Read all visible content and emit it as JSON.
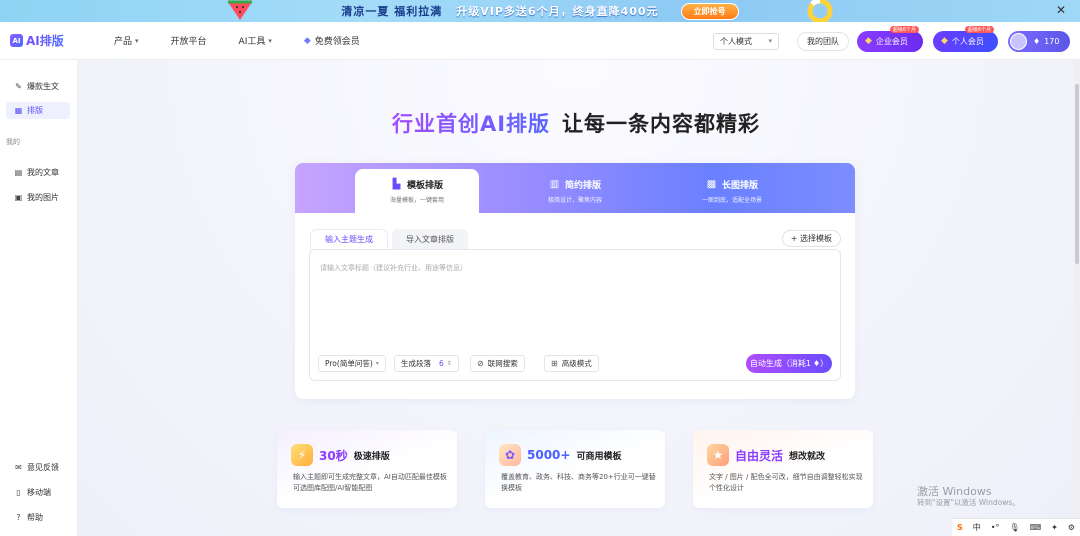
{
  "banner": {
    "text1": "清凉一夏 福利拉满",
    "text2": "升级VIP多送6个月，终身直降400元",
    "cta": "立即抢号",
    "close": "✕"
  },
  "header": {
    "logo_mark": "AI",
    "logo_text": "AI排版",
    "nav": {
      "product": "产品",
      "open_platform": "开放平台",
      "ai_tools": "AI工具",
      "free_member": "免费领会员"
    },
    "mode_select": "个人模式",
    "team": "我的团队",
    "enterprise": "企业会员",
    "enterprise_tag": "超级6个月",
    "personal": "个人会员",
    "personal_tag": "超级6个月",
    "coins": "170"
  },
  "sidebar": {
    "items": [
      {
        "label": "爆款生文",
        "icon": "magic-wand-icon"
      },
      {
        "label": "排版",
        "icon": "layout-icon"
      }
    ],
    "section_mine": "我的",
    "mine_items": [
      {
        "label": "我的文章",
        "icon": "article-icon"
      },
      {
        "label": "我的图片",
        "icon": "image-icon"
      }
    ],
    "bottom_items": [
      {
        "label": "意见反馈",
        "icon": "feedback-icon"
      },
      {
        "label": "移动端",
        "icon": "mobile-icon"
      },
      {
        "label": "帮助",
        "icon": "help-icon"
      }
    ]
  },
  "main": {
    "hero_highlight": "行业首创AI排版",
    "hero_rest": "让每一条内容都精彩",
    "tabs": [
      {
        "label": "模板排版",
        "sub": "海量模板，一键套用"
      },
      {
        "label": "简约排版",
        "sub": "极简设计，聚焦内容"
      },
      {
        "label": "长图排版",
        "sub": "一图到底，适配全场景"
      }
    ],
    "subtabs": {
      "topic": "输入主题生成",
      "import": "导入文章排版"
    },
    "pick_template": "选择模板",
    "input_placeholder": "请输入文章标题（建议补充行业、用途等信息）",
    "controls": {
      "mode": "Pro(简单问答)",
      "paragraphs_label": "生成段落",
      "paragraphs_value": "6",
      "web_search": "联网搜索",
      "advanced": "高级模式"
    },
    "generate": "自动生成（消耗1",
    "features": [
      {
        "big": "30秒",
        "small": "极速排版",
        "desc": "输入主题即可生成完整文章，AI自动匹配最佳模板可选图库配图/AI智能配图"
      },
      {
        "big": "5000+",
        "small": "可商用模板",
        "desc": "覆盖教育、政务、科技、商务等20+行业可一键替换模板"
      },
      {
        "big": "自由灵活",
        "small": "想改就改",
        "desc": "文字 / 图片 / 配色全可改，细节自由调整轻松实现个性化设计"
      }
    ]
  },
  "watermark": {
    "line1": "激活 Windows",
    "line2": "转到\"设置\"以激活 Windows。"
  },
  "ime": {
    "s": "S",
    "zh": "中",
    "dot": "•°"
  },
  "colors": {
    "accent": "#6a4cff",
    "accent2": "#b04cff",
    "banner_bg": "#a3dcf9"
  }
}
